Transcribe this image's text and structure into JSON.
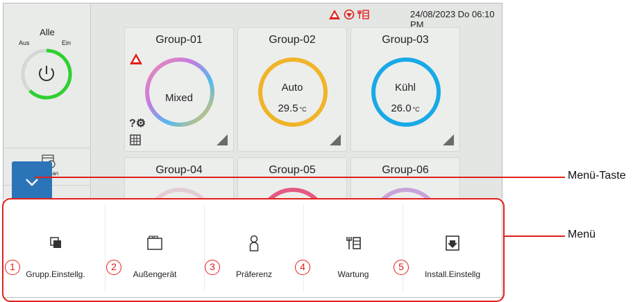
{
  "status": {
    "datetime": "24/08/2023 Do 06:10 PM",
    "icons": [
      "warning-icon",
      "filter-icon",
      "maintenance-icon"
    ]
  },
  "sidebar": {
    "all_label": "Alle",
    "off_label": "Aus",
    "on_label": "Ein",
    "schedule_label": "Zeitplan"
  },
  "groups": [
    {
      "name": "Group-01",
      "mode": "Mixed",
      "temp": "",
      "unit": ""
    },
    {
      "name": "Group-02",
      "mode": "Auto",
      "temp": "29.5",
      "unit": "°C"
    },
    {
      "name": "Group-03",
      "mode": "Kühl",
      "temp": "26.0",
      "unit": "°C"
    },
    {
      "name": "Group-04"
    },
    {
      "name": "Group-05"
    },
    {
      "name": "Group-06"
    }
  ],
  "colors": {
    "auto": "#f0b428",
    "cool": "#19a9e6",
    "accent": "#2b74b8",
    "callout": "#e0201b"
  },
  "menu": {
    "items": [
      {
        "num": "1",
        "label": "Grupp.Einstellg.",
        "icon": "group-settings-icon"
      },
      {
        "num": "2",
        "label": "Außengerät",
        "icon": "outdoor-unit-icon"
      },
      {
        "num": "3",
        "label": "Präferenz",
        "icon": "preference-icon"
      },
      {
        "num": "4",
        "label": "Wartung",
        "icon": "maintenance-icon"
      },
      {
        "num": "5",
        "label": "Install.Einstellg",
        "icon": "install-settings-icon"
      }
    ]
  },
  "callouts": {
    "menu_key": "Menü-Taste",
    "menu": "Menü"
  }
}
